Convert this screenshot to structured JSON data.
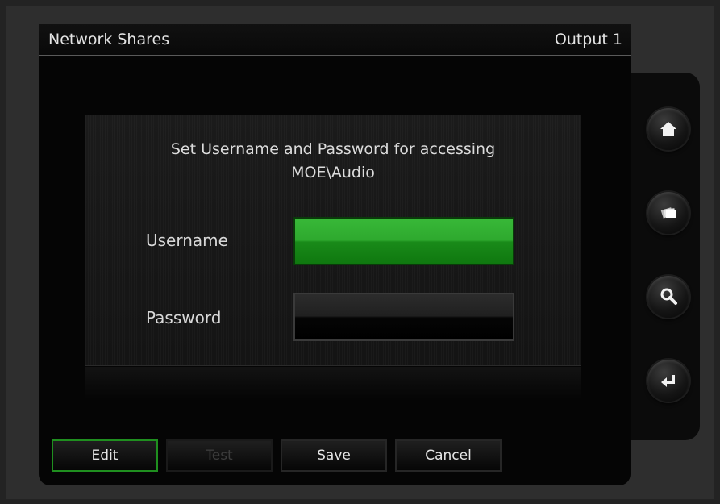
{
  "header": {
    "title": "Network Shares",
    "output_label": "Output 1"
  },
  "dialog": {
    "message_line1": "Set Username and Password for accessing",
    "message_line2": "MOE\\Audio",
    "username": {
      "label": "Username",
      "value": ""
    },
    "password": {
      "label": "Password",
      "value": ""
    }
  },
  "buttons": {
    "edit": "Edit",
    "test": "Test",
    "save": "Save",
    "cancel": "Cancel"
  },
  "side_nav": [
    {
      "icon": "home-icon"
    },
    {
      "icon": "cards-icon"
    },
    {
      "icon": "search-icon"
    },
    {
      "icon": "return-arrow-icon"
    }
  ],
  "colors": {
    "active_field": "#2ea92e",
    "edit_border": "#1f8f1f",
    "disabled_text": "#3c3c3c"
  }
}
